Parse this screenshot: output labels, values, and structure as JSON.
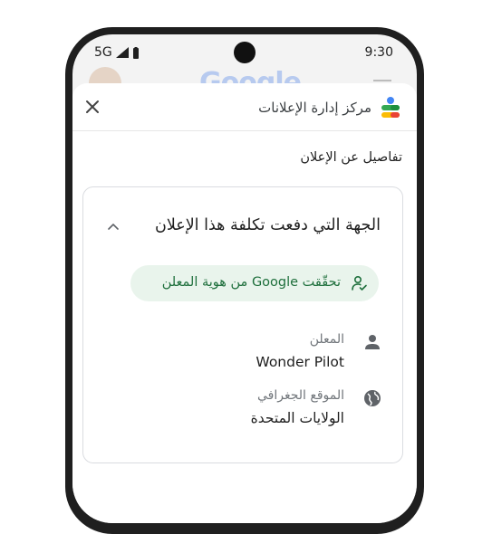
{
  "status_bar": {
    "network": "5G",
    "time": "9:30"
  },
  "background": {
    "logo_text": "Google"
  },
  "sheet": {
    "app_title": "مركز إدارة الإعلانات",
    "section_title": "تفاصيل عن الإعلان",
    "card": {
      "title": "الجهة التي دفعت تكلفة هذا الإعلان",
      "verified_text": "تحقّقت Google من هوية المعلن",
      "rows": [
        {
          "icon": "person-icon",
          "label": "المعلن",
          "value": "Wonder Pilot"
        },
        {
          "icon": "globe-icon",
          "label": "الموقع الجغرافي",
          "value": "الولايات المتحدة"
        }
      ]
    }
  },
  "colors": {
    "chip_bg": "#e9f4ec",
    "chip_text": "#1e6f3c",
    "muted_text": "#70757a"
  }
}
